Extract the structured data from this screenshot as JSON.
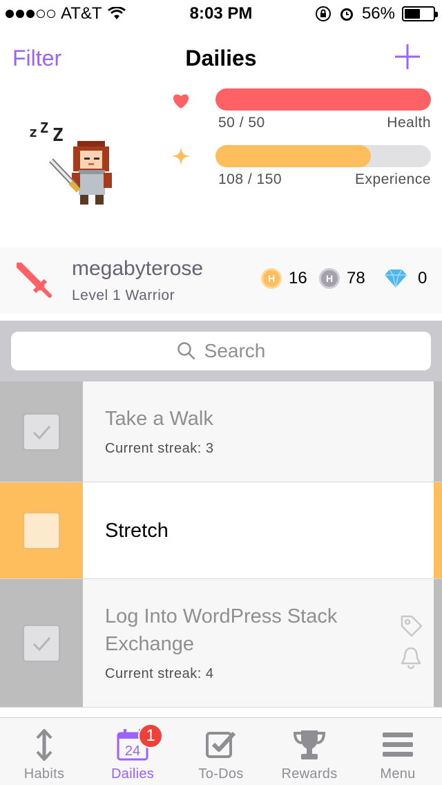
{
  "status_bar": {
    "carrier": "AT&T",
    "time": "8:03 PM",
    "battery": "56%",
    "battery_level": 0.56
  },
  "nav": {
    "filter_label": "Filter",
    "title": "Dailies",
    "add_icon": "plus-icon"
  },
  "stats": {
    "health": {
      "value": "50 / 50",
      "label": "Health",
      "fraction": 1.0,
      "color": "#ff6165"
    },
    "experience": {
      "value": "108 / 150",
      "label": "Experience",
      "fraction": 0.72,
      "color": "#ffbe5d"
    }
  },
  "user": {
    "name": "megabyterose",
    "level": "Level 1 Warrior",
    "gold": "16",
    "silver": "78",
    "gems": "0"
  },
  "search": {
    "placeholder": "Search"
  },
  "tasks": [
    {
      "title": "Take a Walk",
      "streak": "Current streak: 3",
      "completed": true,
      "color": "#bdbdbd"
    },
    {
      "title": "Stretch",
      "streak": "",
      "completed": false,
      "color": "#ffbe5d"
    },
    {
      "title": "Log Into WordPress Stack Exchange",
      "streak": "Current streak: 4",
      "completed": true,
      "color": "#bdbdbd"
    }
  ],
  "tabs": [
    {
      "label": "Habits",
      "icon": "arrows-vertical-icon"
    },
    {
      "label": "Dailies",
      "icon": "calendar-icon",
      "calendar_day": "24",
      "badge": "1",
      "active": true
    },
    {
      "label": "To-Dos",
      "icon": "checkbox-icon"
    },
    {
      "label": "Rewards",
      "icon": "trophy-icon"
    },
    {
      "label": "Menu",
      "icon": "menu-icon"
    }
  ],
  "colors": {
    "accent": "#9a62ff",
    "health": "#ff6165",
    "experience": "#ffbe5d"
  }
}
